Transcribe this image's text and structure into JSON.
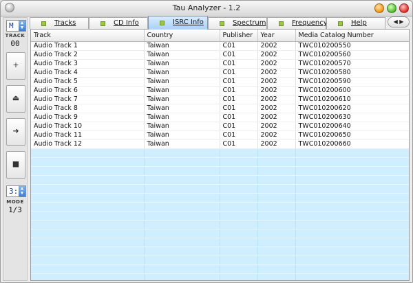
{
  "window": {
    "title": "Tau Analyzer - 1.2"
  },
  "left_panel": {
    "mode_select_value": "M",
    "track_label": "TRACK",
    "track_counter": "00",
    "buttons": {
      "plus": "+",
      "eject": "⏏",
      "next": "➜",
      "stop": "■"
    },
    "page_select_value": "3:",
    "mode_label": "MODE",
    "mode_counter": "1/3"
  },
  "tabs": [
    {
      "label": "Tracks"
    },
    {
      "label": "CD Info"
    },
    {
      "label": "ISRC Info"
    },
    {
      "label": "Spectrum"
    },
    {
      "label": "Frequency"
    },
    {
      "label": "Help"
    }
  ],
  "active_tab": "ISRC Info",
  "table": {
    "columns": [
      "Track",
      "Country",
      "Publisher",
      "Year",
      "Media Catalog Number"
    ],
    "rows": [
      [
        "Audio Track 1",
        "Taiwan",
        "C01",
        "2002",
        "TWC010200550"
      ],
      [
        "Audio Track 2",
        "Taiwan",
        "C01",
        "2002",
        "TWC010200560"
      ],
      [
        "Audio Track 3",
        "Taiwan",
        "C01",
        "2002",
        "TWC010200570"
      ],
      [
        "Audio Track 4",
        "Taiwan",
        "C01",
        "2002",
        "TWC010200580"
      ],
      [
        "Audio Track 5",
        "Taiwan",
        "C01",
        "2002",
        "TWC010200590"
      ],
      [
        "Audio Track 6",
        "Taiwan",
        "C01",
        "2002",
        "TWC010200600"
      ],
      [
        "Audio Track 7",
        "Taiwan",
        "C01",
        "2002",
        "TWC010200610"
      ],
      [
        "Audio Track 8",
        "Taiwan",
        "C01",
        "2002",
        "TWC010200620"
      ],
      [
        "Audio Track 9",
        "Taiwan",
        "C01",
        "2002",
        "TWC010200630"
      ],
      [
        "Audio Track 10",
        "Taiwan",
        "C01",
        "2002",
        "TWC010200640"
      ],
      [
        "Audio Track 11",
        "Taiwan",
        "C01",
        "2002",
        "TWC010200650"
      ],
      [
        "Audio Track 12",
        "Taiwan",
        "C01",
        "2002",
        "TWC010200660"
      ]
    ]
  },
  "colors": {
    "active_tab": "#a9d0fb",
    "empty_rows": "#cfeeff",
    "tab_led": "#9ac93d"
  }
}
